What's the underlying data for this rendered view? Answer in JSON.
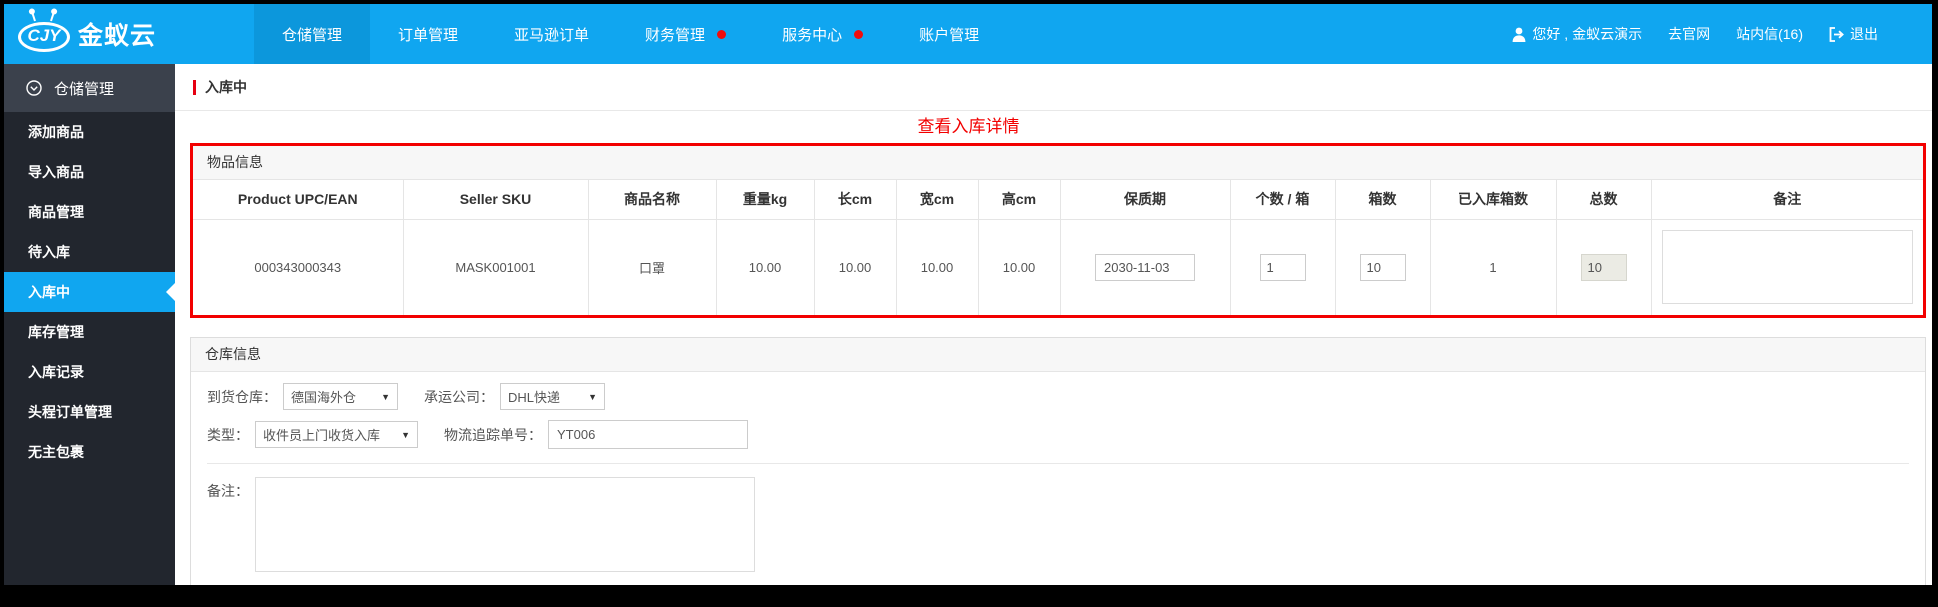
{
  "topbar": {
    "logo": {
      "mark": "CJY",
      "text": "金蚁云"
    },
    "nav": [
      {
        "label": "仓储管理",
        "active": true,
        "dot": false
      },
      {
        "label": "订单管理",
        "active": false,
        "dot": false
      },
      {
        "label": "亚马逊订单",
        "active": false,
        "dot": false
      },
      {
        "label": "财务管理",
        "active": false,
        "dot": true
      },
      {
        "label": "服务中心",
        "active": false,
        "dot": true
      },
      {
        "label": "账户管理",
        "active": false,
        "dot": false
      }
    ],
    "user": {
      "greeting": "您好 , 金蚁云演示",
      "official_site": "去官网",
      "messages": "站内信(16)",
      "logout": "退出"
    }
  },
  "sidebar": {
    "group": "仓储管理",
    "items": [
      {
        "label": "添加商品",
        "active": false
      },
      {
        "label": "导入商品",
        "active": false
      },
      {
        "label": "商品管理",
        "active": false
      },
      {
        "label": "待入库",
        "active": false
      },
      {
        "label": "入库中",
        "active": true
      },
      {
        "label": "库存管理",
        "active": false
      },
      {
        "label": "入库记录",
        "active": false
      },
      {
        "label": "头程订单管理",
        "active": false
      },
      {
        "label": "无主包裹",
        "active": false
      }
    ]
  },
  "main": {
    "breadcrumb": "入库中",
    "annotation": "查看入库详情",
    "item_section": {
      "title": "物品信息",
      "columns": [
        "Product UPC/EAN",
        "Seller SKU",
        "商品名称",
        "重量kg",
        "长cm",
        "宽cm",
        "高cm",
        "保质期",
        "个数 / 箱",
        "箱数",
        "已入库箱数",
        "总数",
        "备注"
      ],
      "row": {
        "upc": "000343000343",
        "sku": "MASK001001",
        "name": "口罩",
        "weight": "10.00",
        "length": "10.00",
        "width": "10.00",
        "height": "10.00",
        "shelf_life": "2030-11-03",
        "pcs_per_box": "1",
        "boxes": "10",
        "received_boxes": "1",
        "total": "10",
        "remark": ""
      }
    },
    "warehouse_section": {
      "title": "仓库信息",
      "arrival_warehouse_label": "到货仓库：",
      "arrival_warehouse_value": "德国海外仓",
      "carrier_label": "承运公司：",
      "carrier_value": "DHL快递",
      "type_label": "类型：",
      "type_value": "收件员上门收货入库",
      "tracking_label": "物流追踪单号：",
      "tracking_value": "YT006",
      "remark_label": "备注：",
      "remark_value": ""
    }
  },
  "icons": {
    "select_arrow": "▼",
    "user": "person-silhouette",
    "logout": "logout-arrow",
    "sidebar_group": "circle-chevron-down",
    "nav_dot": "red-circle"
  },
  "colors": {
    "topbar_blue": "#10A6F0",
    "active_tab_blue": "#0C97DC",
    "sidebar_dark": "#22262E",
    "sidebar_group_bg": "#3B414C",
    "accent_red": "#F20000",
    "notice_dot_red": "#F00C0C",
    "section_header_bg": "#F7F7F7",
    "border_gray": "#E5E5E5",
    "disabled_input_bg": "#EBEBE4"
  }
}
